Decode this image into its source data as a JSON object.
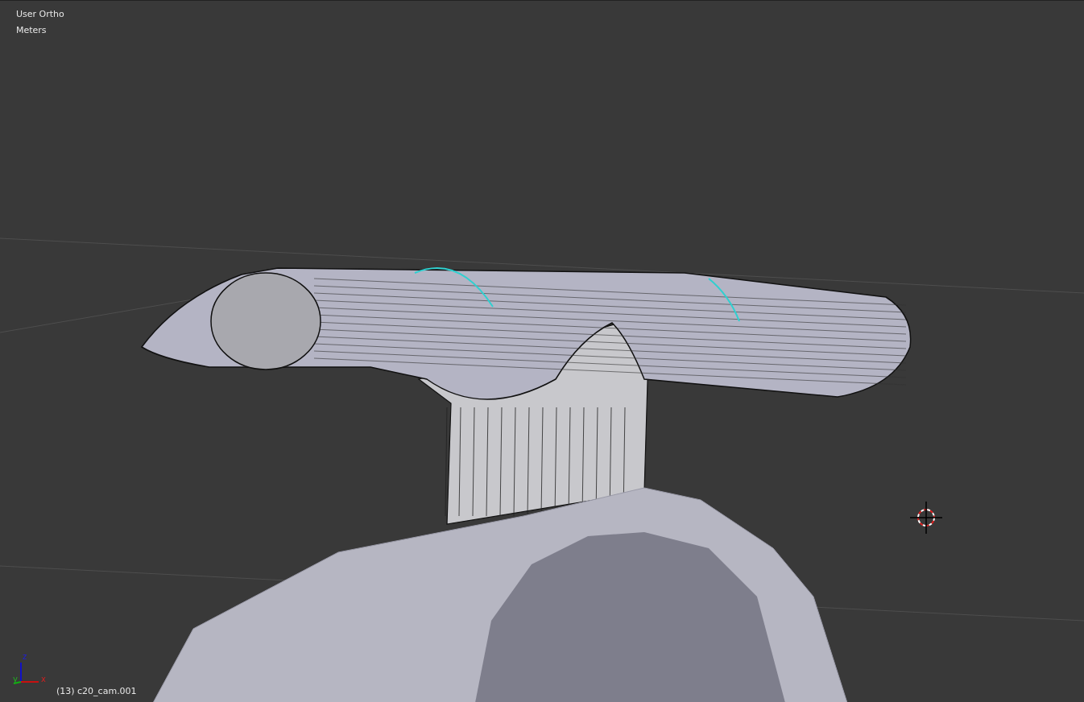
{
  "viewport": {
    "view_name": "User Ortho",
    "units": "Meters",
    "object_label": "(13) c20_cam.001",
    "axis_labels": {
      "x": "x",
      "y": "y",
      "z": "z"
    }
  }
}
